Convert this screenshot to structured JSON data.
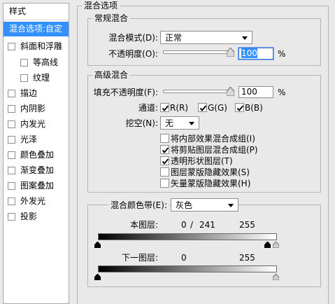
{
  "sidebar": {
    "header": "样式",
    "items": [
      {
        "label": "混合选项:自定",
        "selected": true
      },
      {
        "label": "斜面和浮雕"
      },
      {
        "label": "等高线"
      },
      {
        "label": "纹理"
      },
      {
        "label": "描边"
      },
      {
        "label": "内阴影"
      },
      {
        "label": "内发光"
      },
      {
        "label": "光泽"
      },
      {
        "label": "颜色叠加"
      },
      {
        "label": "渐变叠加"
      },
      {
        "label": "图案叠加"
      },
      {
        "label": "外发光"
      },
      {
        "label": "投影"
      }
    ]
  },
  "blend_options": {
    "title": "混合选项",
    "general": {
      "title": "常规混合",
      "mode_label": "混合模式(D):",
      "mode_value": "正常",
      "opacity_label": "不透明度(O):",
      "opacity_value": "100",
      "opacity_unit": "%",
      "opacity_level": 100
    },
    "advanced": {
      "title": "高级混合",
      "fill_label": "填充不透明度(F):",
      "fill_value": "100",
      "fill_unit": "%",
      "fill_level": 100,
      "channels_label": "通道:",
      "channels": [
        {
          "label": "R(R)",
          "checked": true
        },
        {
          "label": "G(G)",
          "checked": true
        },
        {
          "label": "B(B)",
          "checked": true
        }
      ],
      "knockout_label": "挖空(N):",
      "knockout_value": "无",
      "options": [
        {
          "label": "将内部效果混合成组(I)",
          "checked": false
        },
        {
          "label": "将剪贴图层混合成组(P)",
          "checked": true
        },
        {
          "label": "透明形状图层(T)",
          "checked": true
        },
        {
          "label": "图层蒙版隐藏效果(S)",
          "checked": false
        },
        {
          "label": "矢量蒙版隐藏效果(H)",
          "checked": false
        }
      ]
    },
    "blend_if": {
      "label": "混合颜色带(E):",
      "value": "灰色",
      "this_layer_label": "本图层:",
      "this_layer_low": "0",
      "this_layer_sep": "/",
      "this_layer_mid": "241",
      "this_layer_high": "255",
      "underlying_label": "下一图层:",
      "underlying_low": "0",
      "underlying_high": "255"
    }
  }
}
